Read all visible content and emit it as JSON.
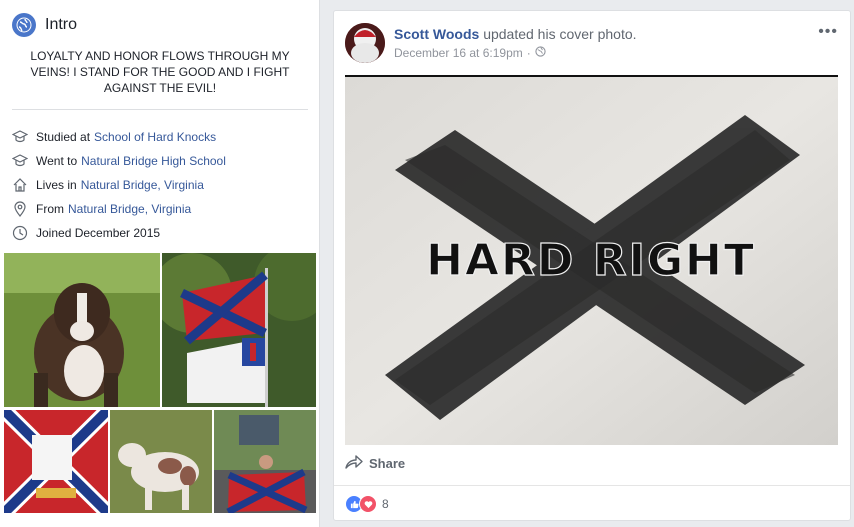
{
  "intro": {
    "title": "Intro",
    "bio": "LOYALTY AND HONOR FLOWS THROUGH MY VEINS! I STAND FOR THE GOOD AND I FIGHT AGAINST THE EVIL!",
    "items": [
      {
        "icon": "graduation-cap-icon",
        "prefix": "Studied at",
        "link": "School of Hard Knocks"
      },
      {
        "icon": "graduation-cap-icon",
        "prefix": "Went to",
        "link": "Natural Bridge High School"
      },
      {
        "icon": "home-icon",
        "prefix": "Lives in",
        "link": "Natural Bridge, Virginia"
      },
      {
        "icon": "location-pin-icon",
        "prefix": "From",
        "link": "Natural Bridge, Virginia"
      },
      {
        "icon": "clock-icon",
        "prefix": "",
        "link": "",
        "text": "Joined December 2015"
      }
    ]
  },
  "post": {
    "author": "Scott Woods",
    "action": "updated his cover photo.",
    "timestamp": "December 16 at 6:19pm",
    "privacy_icon": "globe-icon",
    "more_label": "•••",
    "cover_text": "HARD RIGHT",
    "share_label": "Share",
    "reactions": {
      "count": "8",
      "types": [
        "like",
        "love"
      ]
    }
  },
  "colors": {
    "link": "#365899",
    "background": "#e9ebee",
    "like": "#4a80ff",
    "love": "#f25268"
  }
}
